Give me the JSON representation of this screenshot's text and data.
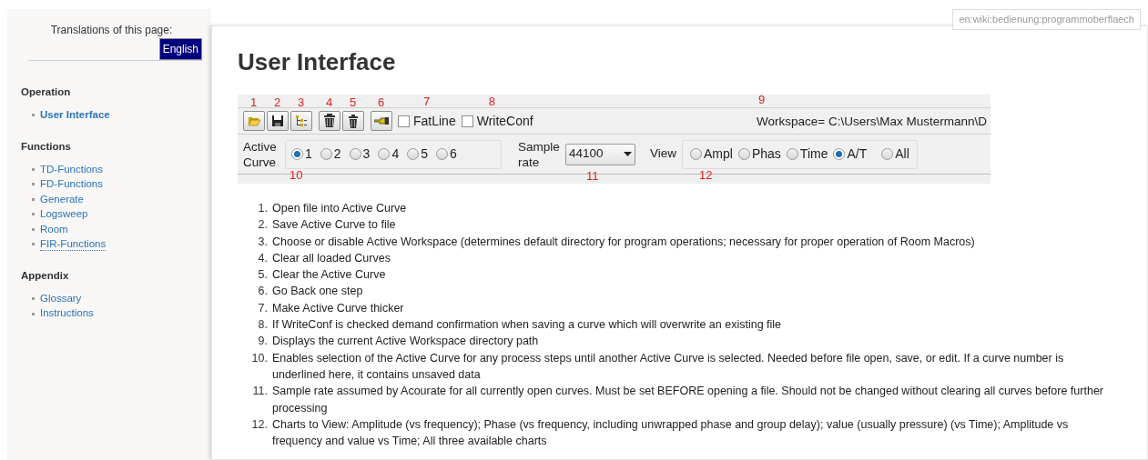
{
  "page_id": "en:wiki:bedienung:programmoberflaech",
  "sidebar": {
    "translations_label": "Translations of this page:",
    "language": "English",
    "sections": [
      {
        "heading": "Operation",
        "items": [
          {
            "label": "User Interface",
            "selected": true,
            "kind": "link"
          }
        ]
      },
      {
        "heading": "Functions",
        "items": [
          {
            "label": "TD-Functions",
            "selected": false,
            "kind": "link"
          },
          {
            "label": "FD-Functions",
            "selected": false,
            "kind": "link"
          },
          {
            "label": "Generate",
            "selected": false,
            "kind": "link"
          },
          {
            "label": "Logsweep",
            "selected": false,
            "kind": "link"
          },
          {
            "label": "Room",
            "selected": false,
            "kind": "link"
          },
          {
            "label": "FIR-Functions",
            "selected": false,
            "kind": "missing"
          }
        ]
      },
      {
        "heading": "Appendix",
        "items": [
          {
            "label": "Glossary",
            "selected": false,
            "kind": "link"
          },
          {
            "label": "Instructions",
            "selected": false,
            "kind": "link"
          }
        ]
      }
    ]
  },
  "title": "User Interface",
  "app_screenshot": {
    "toolbar_groups": [
      [
        {
          "kind": "folder",
          "callout": "1"
        },
        {
          "kind": "save",
          "callout": "2"
        },
        {
          "kind": "tree",
          "callout": "3"
        }
      ],
      [
        {
          "kind": "trash-all",
          "callout": "4"
        },
        {
          "kind": "trash",
          "callout": "5"
        }
      ],
      [
        {
          "kind": "back",
          "callout": "6"
        }
      ]
    ],
    "checkboxes": [
      {
        "label": "FatLine",
        "checked": false,
        "callout": "7"
      },
      {
        "label": "WriteConf",
        "checked": false,
        "callout": "8"
      }
    ],
    "workspace": {
      "text": "Workspace= C:\\Users\\Max Mustermann\\D",
      "callout": "9"
    },
    "active_curve": {
      "label": "Active Curve",
      "callout": "10",
      "options": [
        {
          "label": "1",
          "selected": true
        },
        {
          "label": "2",
          "selected": false
        },
        {
          "label": "3",
          "selected": false
        },
        {
          "label": "4",
          "selected": false
        },
        {
          "label": "5",
          "selected": false
        },
        {
          "label": "6",
          "selected": false
        }
      ]
    },
    "sample_rate": {
      "label": "Sample rate",
      "value": "44100",
      "callout": "11"
    },
    "view": {
      "label": "View",
      "callout": "12",
      "options": [
        {
          "label": "Ampl",
          "selected": false
        },
        {
          "label": "Phas",
          "selected": false
        },
        {
          "label": "Time",
          "selected": false
        },
        {
          "label": "A/T",
          "selected": true
        },
        {
          "label": "All",
          "selected": false
        }
      ]
    }
  },
  "descriptions": [
    {
      "number": "1.",
      "text": "Open file into Active Curve"
    },
    {
      "number": "2.",
      "text": "Save Active Curve to file"
    },
    {
      "number": "3.",
      "text": "Choose or disable Active Workspace (determines default directory for program operations; necessary for proper operation of Room Macros)"
    },
    {
      "number": "4.",
      "text": "Clear all loaded Curves"
    },
    {
      "number": "5.",
      "text": "Clear the Active Curve"
    },
    {
      "number": "6.",
      "text": "Go Back one step"
    },
    {
      "number": "7.",
      "text": "Make Active Curve thicker"
    },
    {
      "number": "8.",
      "text": "If WriteConf is checked demand confirmation when saving a curve which will overwrite an existing file"
    },
    {
      "number": "9.",
      "text": "Displays the current Active Workspace directory path"
    },
    {
      "number": "10.",
      "text": "Enables selection of the Active Curve for any process steps until another Active Curve is selected. Needed before file open, save, or edit. If a curve number is underlined here, it contains unsaved data"
    },
    {
      "number": "11.",
      "text": "Sample rate assumed by Acourate for all currently open curves. Must be set BEFORE opening a file. Should not be changed without clearing all curves before further processing"
    },
    {
      "number": "12.",
      "text": "Charts to View: Amplitude (vs frequency); Phase (vs frequency, including unwrapped phase and group delay); value (usually pressure) (vs Time); Amplitude vs frequency and value vs Time; All three available charts"
    }
  ]
}
